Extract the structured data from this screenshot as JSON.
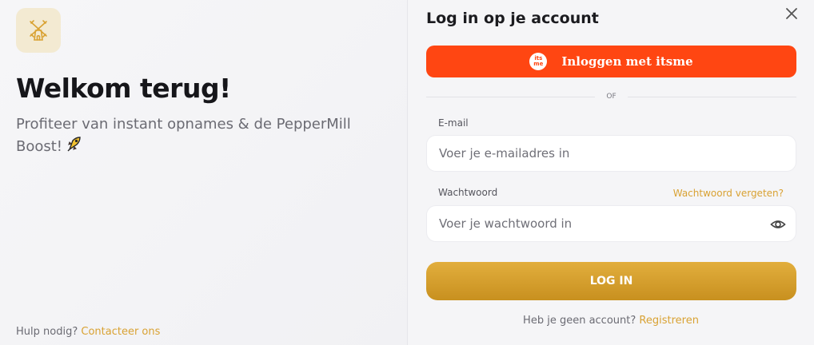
{
  "welcome": {
    "title": "Welkom terug!",
    "subtitle": "Profiteer van instant opnames & de PepperMill Boost!",
    "help_text": "Hulp nodig?",
    "help_link": "Contacteer ons"
  },
  "form": {
    "title": "Log in op je account",
    "itsme_label": "Inloggen met itsme",
    "itsme_logo_text": "its me",
    "or_text": "OF",
    "email_label": "E-mail",
    "email_placeholder": "Voer je e-mailadres in",
    "password_label": "Wachtwoord",
    "forgot_link": "Wachtwoord vergeten?",
    "password_placeholder": "Voer je wachtwoord in",
    "login_label": "LOG IN",
    "no_account_text": "Heb je geen account?",
    "register_link": "Registreren"
  },
  "colors": {
    "accent": "#d9a233",
    "itsme": "#ff4612",
    "login_gradient_top": "#e2ae3d",
    "login_gradient_bottom": "#c8901f"
  },
  "icons": {
    "logo": "windmill-icon",
    "rocket": "rocket-icon",
    "close": "close-icon",
    "eye": "eye-icon"
  }
}
